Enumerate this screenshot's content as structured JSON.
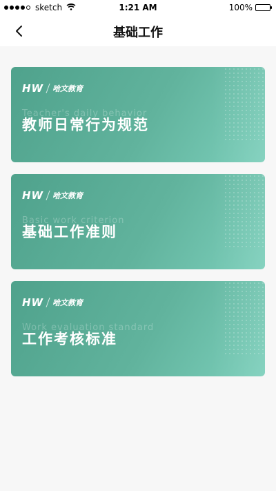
{
  "status_bar": {
    "carrier": "sketch",
    "time": "1:21 AM",
    "battery": "100%"
  },
  "nav": {
    "title": "基础工作"
  },
  "brand": {
    "logo": "HW",
    "name": "哈文教育"
  },
  "cards": [
    {
      "title": "教师日常行为规范",
      "subtitle": "Teacher's daily behavior"
    },
    {
      "title": "基础工作准则",
      "subtitle": "Basic work criterion"
    },
    {
      "title": "工作考核标准",
      "subtitle": "Work evaluation standard"
    }
  ],
  "colors": {
    "card_start": "#4fa28c",
    "card_end": "#7ccfbb",
    "background": "#f7f7f7"
  }
}
